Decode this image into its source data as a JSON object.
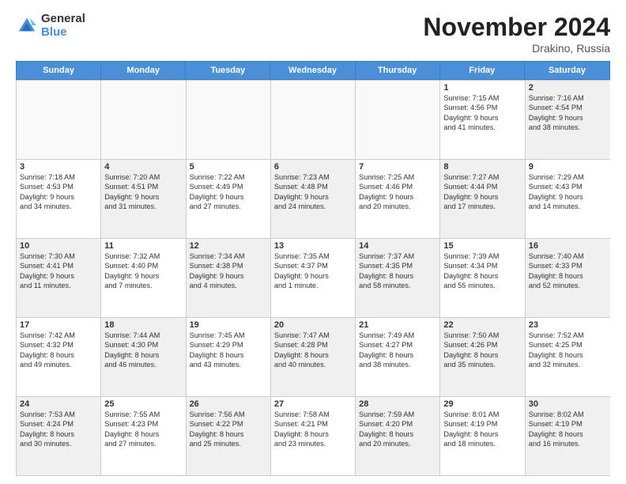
{
  "logo": {
    "general": "General",
    "blue": "Blue"
  },
  "header": {
    "month": "November 2024",
    "location": "Drakino, Russia"
  },
  "days_of_week": [
    "Sunday",
    "Monday",
    "Tuesday",
    "Wednesday",
    "Thursday",
    "Friday",
    "Saturday"
  ],
  "weeks": [
    [
      {
        "day": "",
        "lines": [],
        "empty": true
      },
      {
        "day": "",
        "lines": [],
        "empty": true
      },
      {
        "day": "",
        "lines": [],
        "empty": true
      },
      {
        "day": "",
        "lines": [],
        "empty": true
      },
      {
        "day": "",
        "lines": [],
        "empty": true
      },
      {
        "day": "1",
        "lines": [
          "Sunrise: 7:15 AM",
          "Sunset: 4:56 PM",
          "Daylight: 9 hours",
          "and 41 minutes."
        ],
        "empty": false
      },
      {
        "day": "2",
        "lines": [
          "Sunrise: 7:16 AM",
          "Sunset: 4:54 PM",
          "Daylight: 9 hours",
          "and 38 minutes."
        ],
        "empty": false,
        "shaded": true
      }
    ],
    [
      {
        "day": "3",
        "lines": [
          "Sunrise: 7:18 AM",
          "Sunset: 4:53 PM",
          "Daylight: 9 hours",
          "and 34 minutes."
        ],
        "empty": false
      },
      {
        "day": "4",
        "lines": [
          "Sunrise: 7:20 AM",
          "Sunset: 4:51 PM",
          "Daylight: 9 hours",
          "and 31 minutes."
        ],
        "empty": false,
        "shaded": true
      },
      {
        "day": "5",
        "lines": [
          "Sunrise: 7:22 AM",
          "Sunset: 4:49 PM",
          "Daylight: 9 hours",
          "and 27 minutes."
        ],
        "empty": false
      },
      {
        "day": "6",
        "lines": [
          "Sunrise: 7:23 AM",
          "Sunset: 4:48 PM",
          "Daylight: 9 hours",
          "and 24 minutes."
        ],
        "empty": false,
        "shaded": true
      },
      {
        "day": "7",
        "lines": [
          "Sunrise: 7:25 AM",
          "Sunset: 4:46 PM",
          "Daylight: 9 hours",
          "and 20 minutes."
        ],
        "empty": false
      },
      {
        "day": "8",
        "lines": [
          "Sunrise: 7:27 AM",
          "Sunset: 4:44 PM",
          "Daylight: 9 hours",
          "and 17 minutes."
        ],
        "empty": false,
        "shaded": true
      },
      {
        "day": "9",
        "lines": [
          "Sunrise: 7:29 AM",
          "Sunset: 4:43 PM",
          "Daylight: 9 hours",
          "and 14 minutes."
        ],
        "empty": false
      }
    ],
    [
      {
        "day": "10",
        "lines": [
          "Sunrise: 7:30 AM",
          "Sunset: 4:41 PM",
          "Daylight: 9 hours",
          "and 11 minutes."
        ],
        "empty": false,
        "shaded": true
      },
      {
        "day": "11",
        "lines": [
          "Sunrise: 7:32 AM",
          "Sunset: 4:40 PM",
          "Daylight: 9 hours",
          "and 7 minutes."
        ],
        "empty": false
      },
      {
        "day": "12",
        "lines": [
          "Sunrise: 7:34 AM",
          "Sunset: 4:38 PM",
          "Daylight: 9 hours",
          "and 4 minutes."
        ],
        "empty": false,
        "shaded": true
      },
      {
        "day": "13",
        "lines": [
          "Sunrise: 7:35 AM",
          "Sunset: 4:37 PM",
          "Daylight: 9 hours",
          "and 1 minute."
        ],
        "empty": false
      },
      {
        "day": "14",
        "lines": [
          "Sunrise: 7:37 AM",
          "Sunset: 4:35 PM",
          "Daylight: 8 hours",
          "and 58 minutes."
        ],
        "empty": false,
        "shaded": true
      },
      {
        "day": "15",
        "lines": [
          "Sunrise: 7:39 AM",
          "Sunset: 4:34 PM",
          "Daylight: 8 hours",
          "and 55 minutes."
        ],
        "empty": false
      },
      {
        "day": "16",
        "lines": [
          "Sunrise: 7:40 AM",
          "Sunset: 4:33 PM",
          "Daylight: 8 hours",
          "and 52 minutes."
        ],
        "empty": false,
        "shaded": true
      }
    ],
    [
      {
        "day": "17",
        "lines": [
          "Sunrise: 7:42 AM",
          "Sunset: 4:32 PM",
          "Daylight: 8 hours",
          "and 49 minutes."
        ],
        "empty": false
      },
      {
        "day": "18",
        "lines": [
          "Sunrise: 7:44 AM",
          "Sunset: 4:30 PM",
          "Daylight: 8 hours",
          "and 46 minutes."
        ],
        "empty": false,
        "shaded": true
      },
      {
        "day": "19",
        "lines": [
          "Sunrise: 7:45 AM",
          "Sunset: 4:29 PM",
          "Daylight: 8 hours",
          "and 43 minutes."
        ],
        "empty": false
      },
      {
        "day": "20",
        "lines": [
          "Sunrise: 7:47 AM",
          "Sunset: 4:28 PM",
          "Daylight: 8 hours",
          "and 40 minutes."
        ],
        "empty": false,
        "shaded": true
      },
      {
        "day": "21",
        "lines": [
          "Sunrise: 7:49 AM",
          "Sunset: 4:27 PM",
          "Daylight: 8 hours",
          "and 38 minutes."
        ],
        "empty": false
      },
      {
        "day": "22",
        "lines": [
          "Sunrise: 7:50 AM",
          "Sunset: 4:26 PM",
          "Daylight: 8 hours",
          "and 35 minutes."
        ],
        "empty": false,
        "shaded": true
      },
      {
        "day": "23",
        "lines": [
          "Sunrise: 7:52 AM",
          "Sunset: 4:25 PM",
          "Daylight: 8 hours",
          "and 32 minutes."
        ],
        "empty": false
      }
    ],
    [
      {
        "day": "24",
        "lines": [
          "Sunrise: 7:53 AM",
          "Sunset: 4:24 PM",
          "Daylight: 8 hours",
          "and 30 minutes."
        ],
        "empty": false,
        "shaded": true
      },
      {
        "day": "25",
        "lines": [
          "Sunrise: 7:55 AM",
          "Sunset: 4:23 PM",
          "Daylight: 8 hours",
          "and 27 minutes."
        ],
        "empty": false
      },
      {
        "day": "26",
        "lines": [
          "Sunrise: 7:56 AM",
          "Sunset: 4:22 PM",
          "Daylight: 8 hours",
          "and 25 minutes."
        ],
        "empty": false,
        "shaded": true
      },
      {
        "day": "27",
        "lines": [
          "Sunrise: 7:58 AM",
          "Sunset: 4:21 PM",
          "Daylight: 8 hours",
          "and 23 minutes."
        ],
        "empty": false
      },
      {
        "day": "28",
        "lines": [
          "Sunrise: 7:59 AM",
          "Sunset: 4:20 PM",
          "Daylight: 8 hours",
          "and 20 minutes."
        ],
        "empty": false,
        "shaded": true
      },
      {
        "day": "29",
        "lines": [
          "Sunrise: 8:01 AM",
          "Sunset: 4:19 PM",
          "Daylight: 8 hours",
          "and 18 minutes."
        ],
        "empty": false
      },
      {
        "day": "30",
        "lines": [
          "Sunrise: 8:02 AM",
          "Sunset: 4:19 PM",
          "Daylight: 8 hours",
          "and 16 minutes."
        ],
        "empty": false,
        "shaded": true
      }
    ]
  ]
}
